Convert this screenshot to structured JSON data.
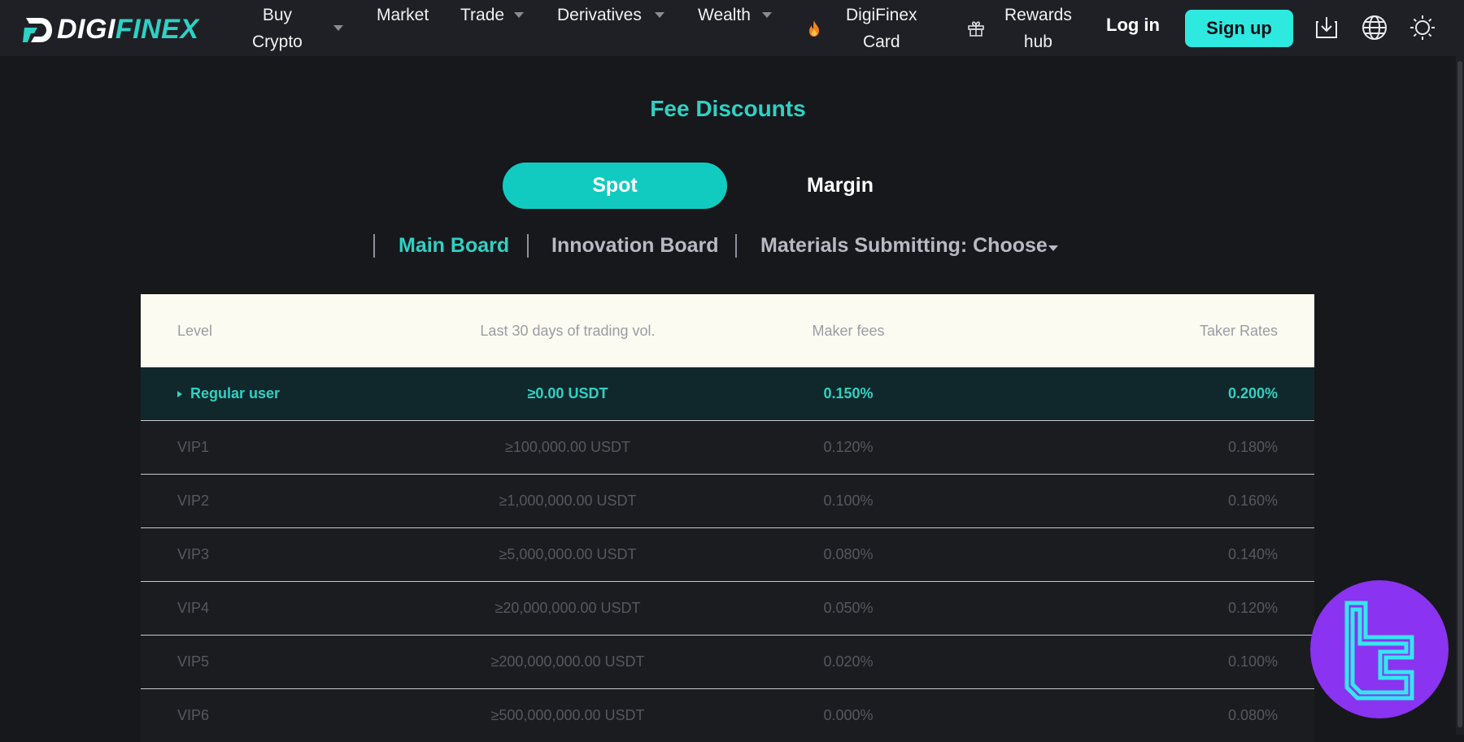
{
  "brand": {
    "name_part1": "DIGI",
    "name_part2": "FINEX"
  },
  "nav": {
    "buy_crypto": {
      "line1": "Buy",
      "line2": "Crypto"
    },
    "market": "Market",
    "trade": "Trade",
    "derivatives": "Derivatives",
    "wealth": "Wealth",
    "card": {
      "line1": "DigiFinex",
      "line2": "Card"
    },
    "rewards": {
      "line1": "Rewards",
      "line2": "hub"
    },
    "login": "Log in",
    "signup": "Sign up"
  },
  "icons": {
    "fire": "fire-icon",
    "gift": "gift-icon",
    "download": "download-icon",
    "globe": "globe-icon",
    "theme": "sun-icon"
  },
  "page": {
    "title": "Fee Discounts",
    "toggle": {
      "spot": "Spot",
      "margin": "Margin",
      "active": "Spot"
    },
    "subtabs": {
      "main": "Main Board",
      "innovation": "Innovation Board",
      "materials": "Materials Submitting: Choose",
      "active": "Main Board"
    }
  },
  "table": {
    "headers": {
      "level": "Level",
      "volume": "Last 30 days of trading vol.",
      "maker": "Maker fees",
      "taker": "Taker Rates"
    },
    "rows": [
      {
        "level": "Regular user",
        "volume": "≥0.00 USDT",
        "maker": "0.150%",
        "taker": "0.200%"
      },
      {
        "level": "VIP1",
        "volume": "≥100,000.00 USDT",
        "maker": "0.120%",
        "taker": "0.180%"
      },
      {
        "level": "VIP2",
        "volume": "≥1,000,000.00 USDT",
        "maker": "0.100%",
        "taker": "0.160%"
      },
      {
        "level": "VIP3",
        "volume": "≥5,000,000.00 USDT",
        "maker": "0.080%",
        "taker": "0.140%"
      },
      {
        "level": "VIP4",
        "volume": "≥20,000,000.00 USDT",
        "maker": "0.050%",
        "taker": "0.120%"
      },
      {
        "level": "VIP5",
        "volume": "≥200,000,000.00 USDT",
        "maker": "0.020%",
        "taker": "0.100%"
      },
      {
        "level": "VIP6",
        "volume": "≥500,000,000.00 USDT",
        "maker": "0.000%",
        "taker": "0.080%"
      }
    ]
  },
  "colors": {
    "accent": "#2fd1c4",
    "signup_bg": "#2ee9e0",
    "spot_bg": "#12cbc0",
    "badge": "#8a33f0"
  }
}
